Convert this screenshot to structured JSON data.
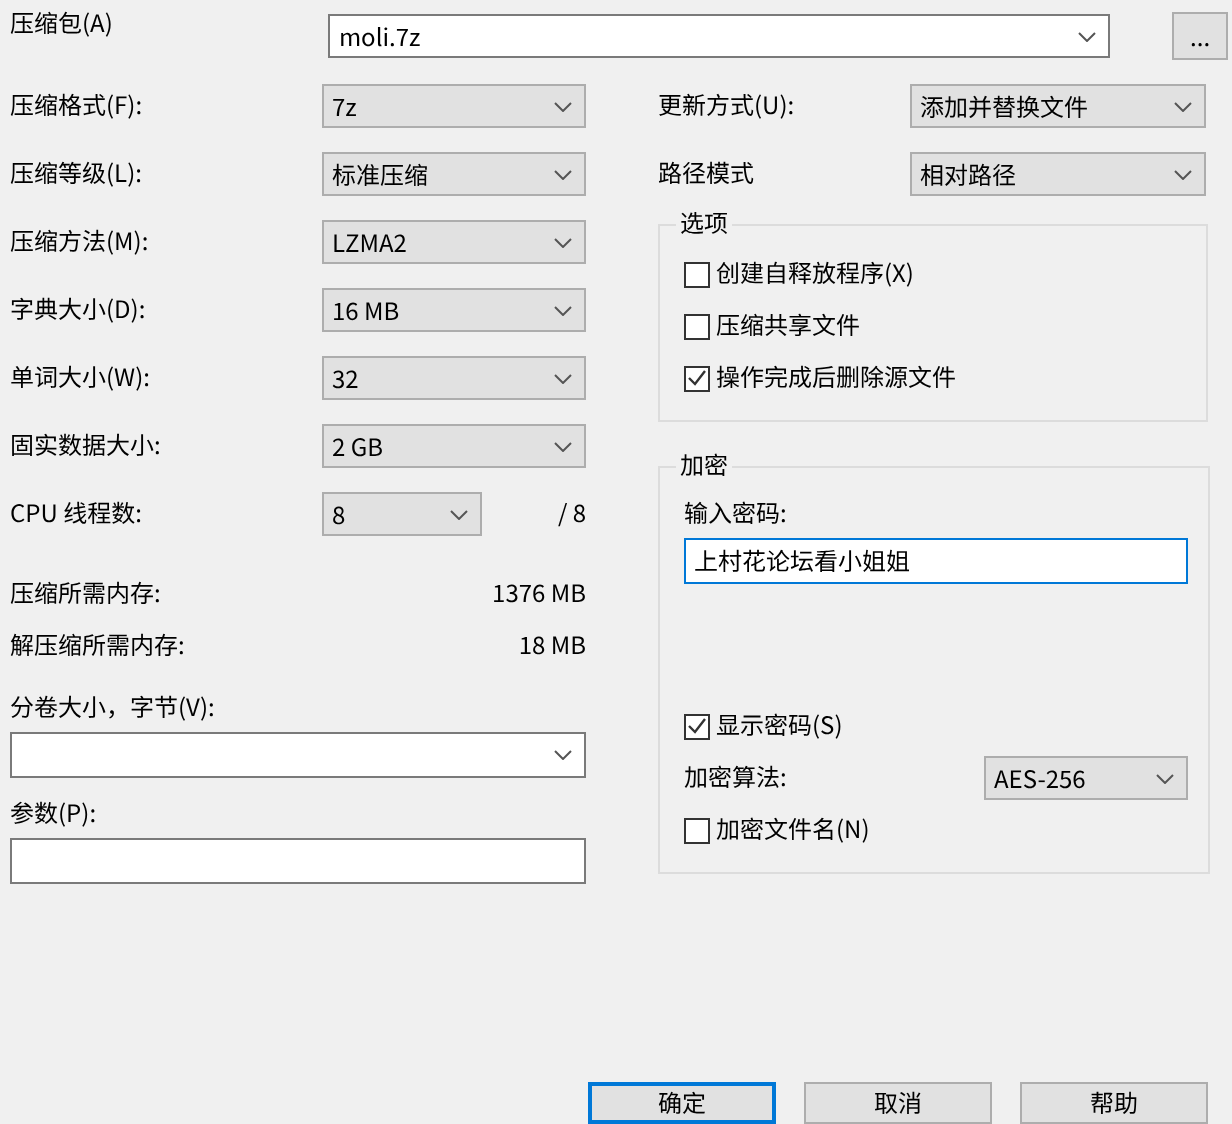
{
  "archive": {
    "label": "压缩包(A)",
    "value": "moli.7z",
    "browse": "..."
  },
  "settings": [
    {
      "label": "压缩格式(F):",
      "value": "7z",
      "kind": "wide"
    },
    {
      "label": "压缩等级(L):",
      "value": "标准压缩",
      "kind": "wide"
    },
    {
      "label": "压缩方法(M):",
      "value": "LZMA2",
      "kind": "wide"
    },
    {
      "label": "字典大小(D):",
      "value": "16 MB",
      "kind": "wide"
    },
    {
      "label": "单词大小(W):",
      "value": "32",
      "kind": "wide"
    },
    {
      "label": "固实数据大小:",
      "value": "2 GB",
      "kind": "wide"
    },
    {
      "label": "CPU 线程数:",
      "value": "8",
      "kind": "narrow",
      "suffix": "/ 8"
    }
  ],
  "memory": [
    {
      "label": "压缩所需内存:",
      "value": "1376 MB"
    },
    {
      "label": "解压缩所需内存:",
      "value": "18 MB"
    }
  ],
  "volume": {
    "label": "分卷大小，字节(V):"
  },
  "params": {
    "label": "参数(P):"
  },
  "update": {
    "label": "更新方式(U):",
    "value": "添加并替换文件"
  },
  "path_mode": {
    "label": "路径模式",
    "value": "相对路径"
  },
  "options": {
    "title": "选项",
    "items": [
      {
        "label": "创建自释放程序(X)",
        "checked": false
      },
      {
        "label": "压缩共享文件",
        "checked": false
      },
      {
        "label": "操作完成后删除源文件",
        "checked": true
      }
    ]
  },
  "encryption": {
    "title": "加密",
    "password_label": "输入密码:",
    "password": "上村花论坛看小姐姐",
    "show_password": {
      "label": "显示密码(S)",
      "checked": true
    },
    "method_label": "加密算法:",
    "method": "AES-256",
    "encrypt_names": {
      "label": "加密文件名(N)",
      "checked": false
    }
  },
  "buttons": [
    {
      "label": "确定",
      "default": true
    },
    {
      "label": "取消",
      "default": false
    },
    {
      "label": "帮助",
      "default": false
    }
  ]
}
